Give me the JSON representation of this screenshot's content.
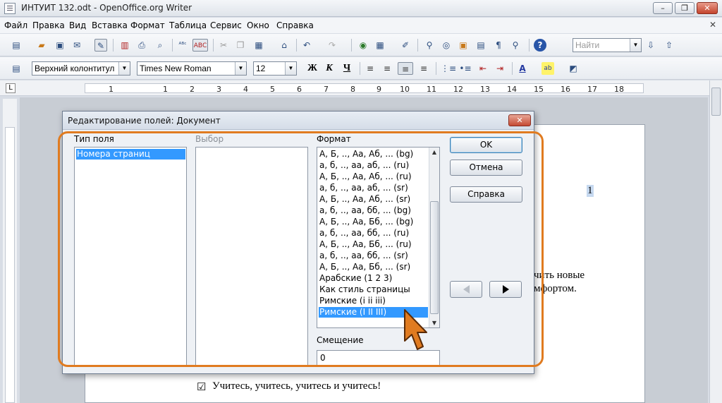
{
  "window": {
    "title": "ИНТУИТ 132.odt - OpenOffice.org Writer",
    "controls": {
      "minimize": "–",
      "maximize": "❐",
      "close": "✕"
    }
  },
  "menu": {
    "items": [
      "Файл",
      "Правка",
      "Вид",
      "Вставка",
      "Формат",
      "Таблица",
      "Сервис",
      "Окно",
      "Справка"
    ],
    "close_doc": "✕"
  },
  "toolbar1": {
    "find_placeholder": "Найти"
  },
  "toolbar2": {
    "paragraph_style": "Верхний колонтитул",
    "font_name": "Times New Roman",
    "font_size": "12",
    "bold": "Ж",
    "italic": "К",
    "underline": "Ч"
  },
  "ruler": {
    "corner": "L",
    "labels": [
      "1",
      "1",
      "2",
      "3",
      "4",
      "5",
      "6",
      "7",
      "8",
      "9",
      "10",
      "11",
      "12",
      "13",
      "14",
      "15",
      "16",
      "17",
      "18"
    ]
  },
  "document": {
    "page_number": "1",
    "text_fragment_1": "чить новые",
    "text_fragment_2": "мфортом.",
    "checkbox_line": "Учитесь, учитесь, учитесь и учитесь!",
    "checkbox_glyph": "☑"
  },
  "dialog": {
    "title": "Редактирование полей: Документ",
    "close": "✕",
    "field_type_label": "Тип поля",
    "field_types": [
      "Номера страниц"
    ],
    "selection_label": "Выбор",
    "format_label": "Формат",
    "formats": [
      "А, Б, .., Аа, Аб, ... (bg)",
      "а, б, .., аа, аб, ... (ru)",
      "А, Б, .., Аа, Аб, ... (ru)",
      "а, б, .., аа, аб, ... (sr)",
      "А, Б, .., Аа, Аб, ... (sr)",
      "а, б, .., аа, бб, ... (bg)",
      "А, Б, .., Аа, Бб, ... (bg)",
      "а, б, .., аа, бб, ... (ru)",
      "А, Б, .., Аа, Бб, ... (ru)",
      "а, б, .., аа, бб, ... (sr)",
      "А, Б, .., Аа, Бб, ... (sr)",
      "Арабские (1 2 3)",
      "Как стиль страницы",
      "Римские (i ii iii)",
      "Римские (I II III)"
    ],
    "selected_format_index": 14,
    "offset_label": "Смещение",
    "offset_value": "0",
    "buttons": {
      "ok": "OK",
      "cancel": "Отмена",
      "help": "Справка"
    }
  },
  "colors": {
    "highlight_frame": "#e07b20",
    "selection": "#3399ff",
    "cursor": "#e07b20"
  }
}
